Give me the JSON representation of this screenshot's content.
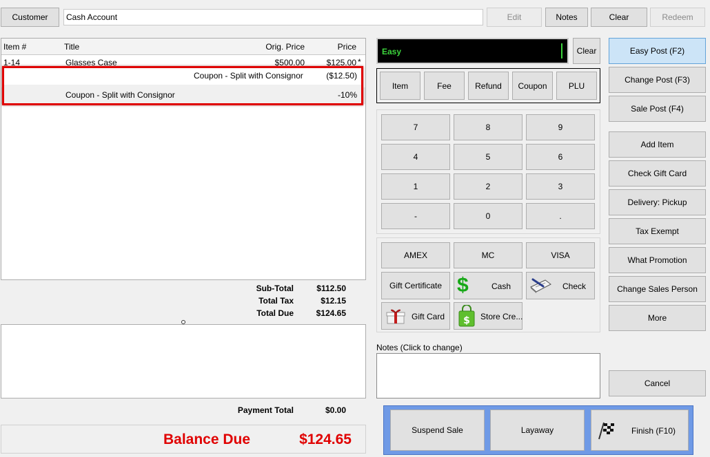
{
  "top": {
    "customer_label": "Customer",
    "account_value": "Cash Account",
    "edit_label": "Edit",
    "notes_label": "Notes",
    "clear_label": "Clear",
    "redeem_label": "Redeem"
  },
  "items_table": {
    "headers": [
      "Item #",
      "Title",
      "Orig. Price",
      "Price"
    ],
    "rows": [
      {
        "item": "1-14",
        "title": "Glasses Case",
        "orig": "$500.00",
        "price": "$125.00",
        "flag": "*"
      },
      {
        "desc": "Coupon - Split with Consignor",
        "amount": "($12.50)"
      },
      {
        "desc": "Coupon - Split with Consignor",
        "amount": "-10%"
      }
    ]
  },
  "totals": {
    "subtotal_label": "Sub-Total",
    "subtotal": "$112.50",
    "tax_label": "Total Tax",
    "tax": "$12.15",
    "due_label": "Total Due",
    "due": "$124.65",
    "payment_label": "Payment Total",
    "payment": "$0.00",
    "balance_label": "Balance Due",
    "balance": "$124.65"
  },
  "entry": {
    "mode": "Easy",
    "clear_label": "Clear"
  },
  "modes": [
    "Item",
    "Fee",
    "Refund",
    "Coupon",
    "PLU"
  ],
  "keypad": [
    "7",
    "8",
    "9",
    "4",
    "5",
    "6",
    "1",
    "2",
    "3",
    "-",
    "0",
    "."
  ],
  "tenders": {
    "amex": "AMEX",
    "mc": "MC",
    "visa": "VISA",
    "gift_certificate": "Gift Certificate",
    "cash": "Cash",
    "check": "Check",
    "gift_card": "Gift Card",
    "store_credit": "Store Cre..."
  },
  "notes": {
    "label": "Notes (Click to change)",
    "value": ""
  },
  "actions": {
    "easy_post": "Easy Post (F2)",
    "change_post": "Change Post (F3)",
    "sale_post": "Sale Post (F4)",
    "add_item": "Add Item",
    "check_gift_card": "Check Gift Card",
    "delivery": "Delivery: Pickup",
    "tax_exempt": "Tax Exempt",
    "what_promotion": "What Promotion",
    "change_sales_person": "Change Sales Person",
    "more": "More",
    "cancel": "Cancel"
  },
  "bottom": {
    "suspend": "Suspend Sale",
    "layaway": "Layaway",
    "finish": "Finish (F10)"
  },
  "colors": {
    "highlight": "#e00000",
    "balance": "#e00000",
    "easy_text": "#3cd43c",
    "bottom_bar": "#6f9ae6"
  },
  "icons": [
    "dollar-icon",
    "check-writing-icon",
    "gift-box-icon",
    "shopping-bag-icon",
    "checkered-flag-icon"
  ]
}
